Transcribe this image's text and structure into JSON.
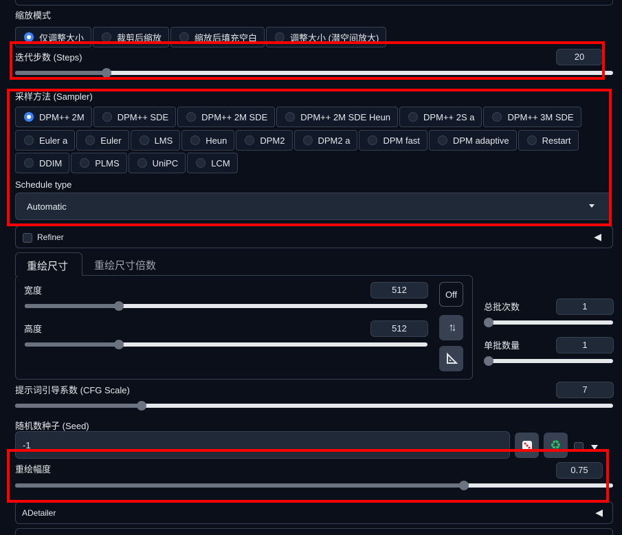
{
  "resize_mode": {
    "label": "缩放模式",
    "options": [
      "仅调整大小",
      "裁剪后缩放",
      "缩放后填充空白",
      "调整大小 (潜空间放大)"
    ],
    "selected": 0
  },
  "steps": {
    "label": "迭代步数 (Steps)",
    "value": "20",
    "fraction": 0.153
  },
  "sampler": {
    "label": "采样方法 (Sampler)",
    "row1": [
      "DPM++ 2M",
      "DPM++ SDE",
      "DPM++ 2M SDE",
      "DPM++ 2M SDE Heun",
      "DPM++ 2S a",
      "DPM++ 3M SDE"
    ],
    "row2": [
      "Euler a",
      "Euler",
      "LMS",
      "Heun",
      "DPM2",
      "DPM2 a",
      "DPM fast",
      "DPM adaptive",
      "Restart"
    ],
    "row3": [
      "DDIM",
      "PLMS",
      "UniPC",
      "LCM"
    ],
    "selected": "DPM++ 2M"
  },
  "schedule": {
    "label": "Schedule type",
    "value": "Automatic"
  },
  "refiner": {
    "label": "Refiner"
  },
  "tabs": {
    "active": "重绘尺寸",
    "inactive": "重绘尺寸倍数"
  },
  "width": {
    "label": "宽度",
    "value": "512",
    "fraction": 0.234
  },
  "height": {
    "label": "高度",
    "value": "512",
    "fraction": 0.234
  },
  "off_label": "Off",
  "batch_count": {
    "label": "总批次数",
    "value": "1",
    "fraction": 0.0
  },
  "batch_size": {
    "label": "单批数量",
    "value": "1",
    "fraction": 0.0
  },
  "cfg": {
    "label": "提示词引导系数 (CFG Scale)",
    "value": "7",
    "fraction": 0.211
  },
  "seed": {
    "label": "随机数种子 (Seed)",
    "value": "-1"
  },
  "denoise": {
    "label": "重绘幅度",
    "value": "0.75",
    "fraction": 0.75
  },
  "adetailer": {
    "label": "ADetailer"
  },
  "colors": {
    "accent": "#3b82f6",
    "highlight": "#ff0000",
    "recycle": "#22c55e"
  }
}
